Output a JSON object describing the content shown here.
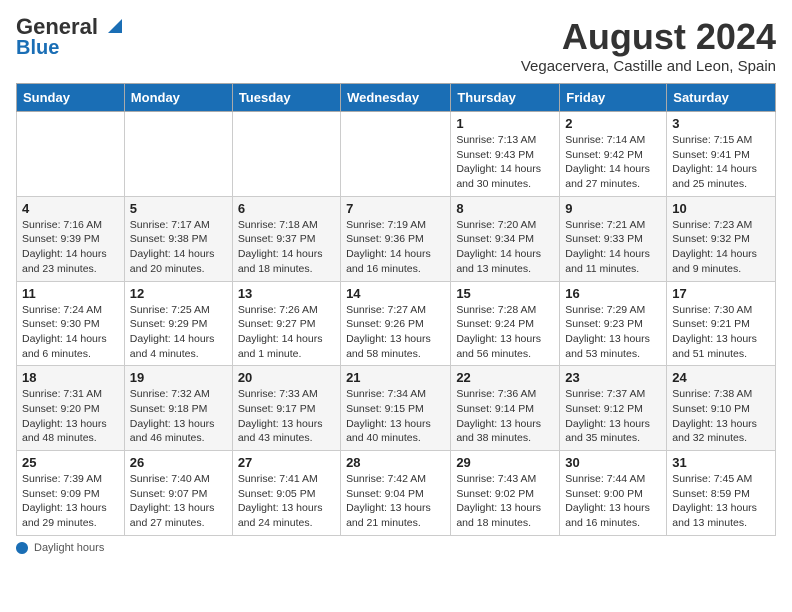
{
  "header": {
    "logo_general": "General",
    "logo_blue": "Blue",
    "month_year": "August 2024",
    "location": "Vegacervera, Castille and Leon, Spain"
  },
  "weekdays": [
    "Sunday",
    "Monday",
    "Tuesday",
    "Wednesday",
    "Thursday",
    "Friday",
    "Saturday"
  ],
  "weeks": [
    [
      {
        "day": "",
        "info": ""
      },
      {
        "day": "",
        "info": ""
      },
      {
        "day": "",
        "info": ""
      },
      {
        "day": "",
        "info": ""
      },
      {
        "day": "1",
        "info": "Sunrise: 7:13 AM\nSunset: 9:43 PM\nDaylight: 14 hours and 30 minutes."
      },
      {
        "day": "2",
        "info": "Sunrise: 7:14 AM\nSunset: 9:42 PM\nDaylight: 14 hours and 27 minutes."
      },
      {
        "day": "3",
        "info": "Sunrise: 7:15 AM\nSunset: 9:41 PM\nDaylight: 14 hours and 25 minutes."
      }
    ],
    [
      {
        "day": "4",
        "info": "Sunrise: 7:16 AM\nSunset: 9:39 PM\nDaylight: 14 hours and 23 minutes."
      },
      {
        "day": "5",
        "info": "Sunrise: 7:17 AM\nSunset: 9:38 PM\nDaylight: 14 hours and 20 minutes."
      },
      {
        "day": "6",
        "info": "Sunrise: 7:18 AM\nSunset: 9:37 PM\nDaylight: 14 hours and 18 minutes."
      },
      {
        "day": "7",
        "info": "Sunrise: 7:19 AM\nSunset: 9:36 PM\nDaylight: 14 hours and 16 minutes."
      },
      {
        "day": "8",
        "info": "Sunrise: 7:20 AM\nSunset: 9:34 PM\nDaylight: 14 hours and 13 minutes."
      },
      {
        "day": "9",
        "info": "Sunrise: 7:21 AM\nSunset: 9:33 PM\nDaylight: 14 hours and 11 minutes."
      },
      {
        "day": "10",
        "info": "Sunrise: 7:23 AM\nSunset: 9:32 PM\nDaylight: 14 hours and 9 minutes."
      }
    ],
    [
      {
        "day": "11",
        "info": "Sunrise: 7:24 AM\nSunset: 9:30 PM\nDaylight: 14 hours and 6 minutes."
      },
      {
        "day": "12",
        "info": "Sunrise: 7:25 AM\nSunset: 9:29 PM\nDaylight: 14 hours and 4 minutes."
      },
      {
        "day": "13",
        "info": "Sunrise: 7:26 AM\nSunset: 9:27 PM\nDaylight: 14 hours and 1 minute."
      },
      {
        "day": "14",
        "info": "Sunrise: 7:27 AM\nSunset: 9:26 PM\nDaylight: 13 hours and 58 minutes."
      },
      {
        "day": "15",
        "info": "Sunrise: 7:28 AM\nSunset: 9:24 PM\nDaylight: 13 hours and 56 minutes."
      },
      {
        "day": "16",
        "info": "Sunrise: 7:29 AM\nSunset: 9:23 PM\nDaylight: 13 hours and 53 minutes."
      },
      {
        "day": "17",
        "info": "Sunrise: 7:30 AM\nSunset: 9:21 PM\nDaylight: 13 hours and 51 minutes."
      }
    ],
    [
      {
        "day": "18",
        "info": "Sunrise: 7:31 AM\nSunset: 9:20 PM\nDaylight: 13 hours and 48 minutes."
      },
      {
        "day": "19",
        "info": "Sunrise: 7:32 AM\nSunset: 9:18 PM\nDaylight: 13 hours and 46 minutes."
      },
      {
        "day": "20",
        "info": "Sunrise: 7:33 AM\nSunset: 9:17 PM\nDaylight: 13 hours and 43 minutes."
      },
      {
        "day": "21",
        "info": "Sunrise: 7:34 AM\nSunset: 9:15 PM\nDaylight: 13 hours and 40 minutes."
      },
      {
        "day": "22",
        "info": "Sunrise: 7:36 AM\nSunset: 9:14 PM\nDaylight: 13 hours and 38 minutes."
      },
      {
        "day": "23",
        "info": "Sunrise: 7:37 AM\nSunset: 9:12 PM\nDaylight: 13 hours and 35 minutes."
      },
      {
        "day": "24",
        "info": "Sunrise: 7:38 AM\nSunset: 9:10 PM\nDaylight: 13 hours and 32 minutes."
      }
    ],
    [
      {
        "day": "25",
        "info": "Sunrise: 7:39 AM\nSunset: 9:09 PM\nDaylight: 13 hours and 29 minutes."
      },
      {
        "day": "26",
        "info": "Sunrise: 7:40 AM\nSunset: 9:07 PM\nDaylight: 13 hours and 27 minutes."
      },
      {
        "day": "27",
        "info": "Sunrise: 7:41 AM\nSunset: 9:05 PM\nDaylight: 13 hours and 24 minutes."
      },
      {
        "day": "28",
        "info": "Sunrise: 7:42 AM\nSunset: 9:04 PM\nDaylight: 13 hours and 21 minutes."
      },
      {
        "day": "29",
        "info": "Sunrise: 7:43 AM\nSunset: 9:02 PM\nDaylight: 13 hours and 18 minutes."
      },
      {
        "day": "30",
        "info": "Sunrise: 7:44 AM\nSunset: 9:00 PM\nDaylight: 13 hours and 16 minutes."
      },
      {
        "day": "31",
        "info": "Sunrise: 7:45 AM\nSunset: 8:59 PM\nDaylight: 13 hours and 13 minutes."
      }
    ]
  ],
  "footer": {
    "note": "Daylight hours"
  }
}
